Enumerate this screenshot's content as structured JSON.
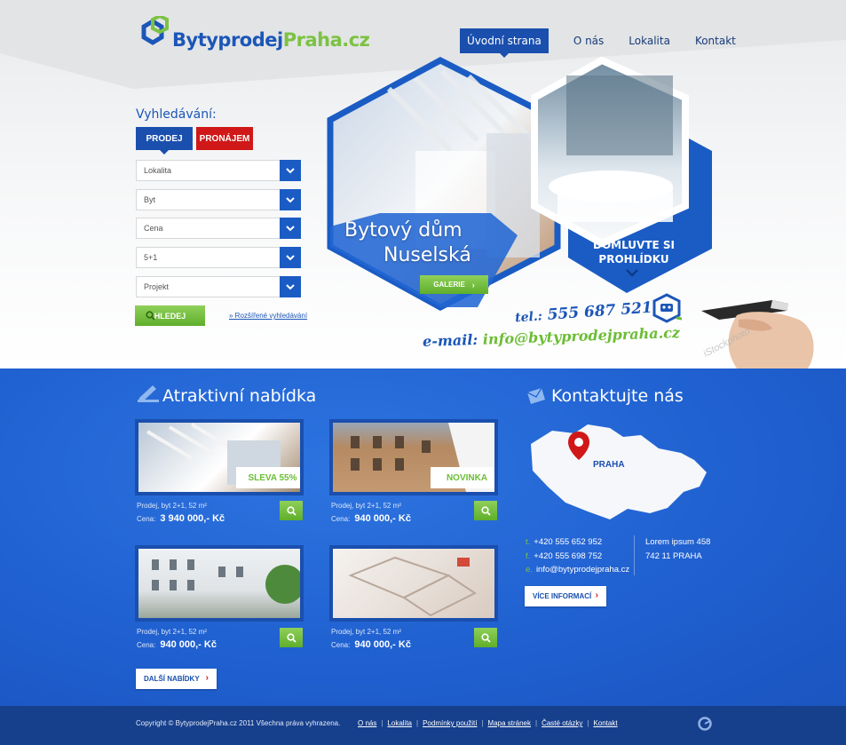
{
  "logo": {
    "part1": "Bytyprodej",
    "part2": "Praha.cz"
  },
  "nav": [
    {
      "label": "Úvodní strana",
      "active": true
    },
    {
      "label": "O nás"
    },
    {
      "label": "Lokalita"
    },
    {
      "label": "Kontakt"
    }
  ],
  "search": {
    "title": "Vyhledávání:",
    "tab_sale": "PRODEJ",
    "tab_rent": "PRONÁJEM",
    "selects": [
      "Lokalita",
      "Byt",
      "Cena",
      "5+1",
      "Projekt"
    ],
    "button": "HLEDEJ",
    "advanced": "» Rozšířené vyhledávání"
  },
  "hero": {
    "title_line1": "Bytový dům",
    "title_line2": "Nuselská",
    "gallery_button": "GALERIE",
    "viewing_line1": "DOMLUVTE SI",
    "viewing_line2": "PROHLÍDKU",
    "tel_label": "tel.:",
    "tel_value": "555 687 521",
    "mail_label": "e-mail:",
    "mail_value": "info@bytyprodejpraha.cz",
    "watermark": "iStockphoto"
  },
  "offers": {
    "title": "Atraktivní nabídka",
    "items": [
      {
        "desc": "Prodej, byt 2+1, 52 m²",
        "price_label": "Cena:",
        "price": "3 940 000,- Kč",
        "badge": "SLEVA 55%"
      },
      {
        "desc": "Prodej, byt 2+1, 52 m²",
        "price_label": "Cena:",
        "price": "940 000,- Kč",
        "badge": "NOVINKA"
      },
      {
        "desc": "Prodej, byt 2+1, 52 m²",
        "price_label": "Cena:",
        "price": "940 000,- Kč"
      },
      {
        "desc": "Prodej, byt 2+1, 52 m²",
        "price_label": "Cena:",
        "price": "940 000,- Kč"
      }
    ],
    "more_button": "DALŠÍ NABÍDKY"
  },
  "contact": {
    "title": "Kontaktujte nás",
    "map_label": "PRAHA",
    "tel_key": "t.",
    "tel": "+420 555 652 952",
    "fax_key": "f.",
    "fax": "+420 555 698 752",
    "email_key": "e.",
    "email": "info@bytyprodejpraha.cz",
    "address1": "Lorem ipsum 458",
    "address2": "742 11 PRAHA",
    "more_button": "VÍCE INFORMACÍ"
  },
  "footer": {
    "copyright": "Copyright © BytyprodejPraha.cz 2011 Všechna práva vyhrazena.",
    "links": [
      "O nás",
      "Lokalita",
      "Podmínky použití",
      "Mapa stránek",
      "Časté otázky",
      "Kontakt"
    ]
  },
  "colors": {
    "brand_blue": "#1a4fae",
    "accent_green": "#6cbd35",
    "accent_red": "#d01818"
  }
}
